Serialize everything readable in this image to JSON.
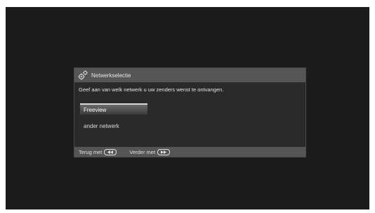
{
  "dialog": {
    "title": "Netwerkselectie",
    "icon": "gears-icon",
    "prompt": "Geef aan van welk netwerk u uw zenders wenst te ontvangen.",
    "options": [
      {
        "label": "Freeview",
        "selected": true
      },
      {
        "label": "ander netwerk",
        "selected": false
      }
    ],
    "footer": {
      "back_label": "Terug met",
      "back_icon": "rewind-key-icon",
      "next_label": "Verder met",
      "next_icon": "fast-forward-key-icon"
    }
  },
  "colors": {
    "screen_bg": "#1c1c1c",
    "panel_bg": "#2a2a2a",
    "header_bg": "#555555",
    "selection_highlight": "#d8d8d8"
  }
}
